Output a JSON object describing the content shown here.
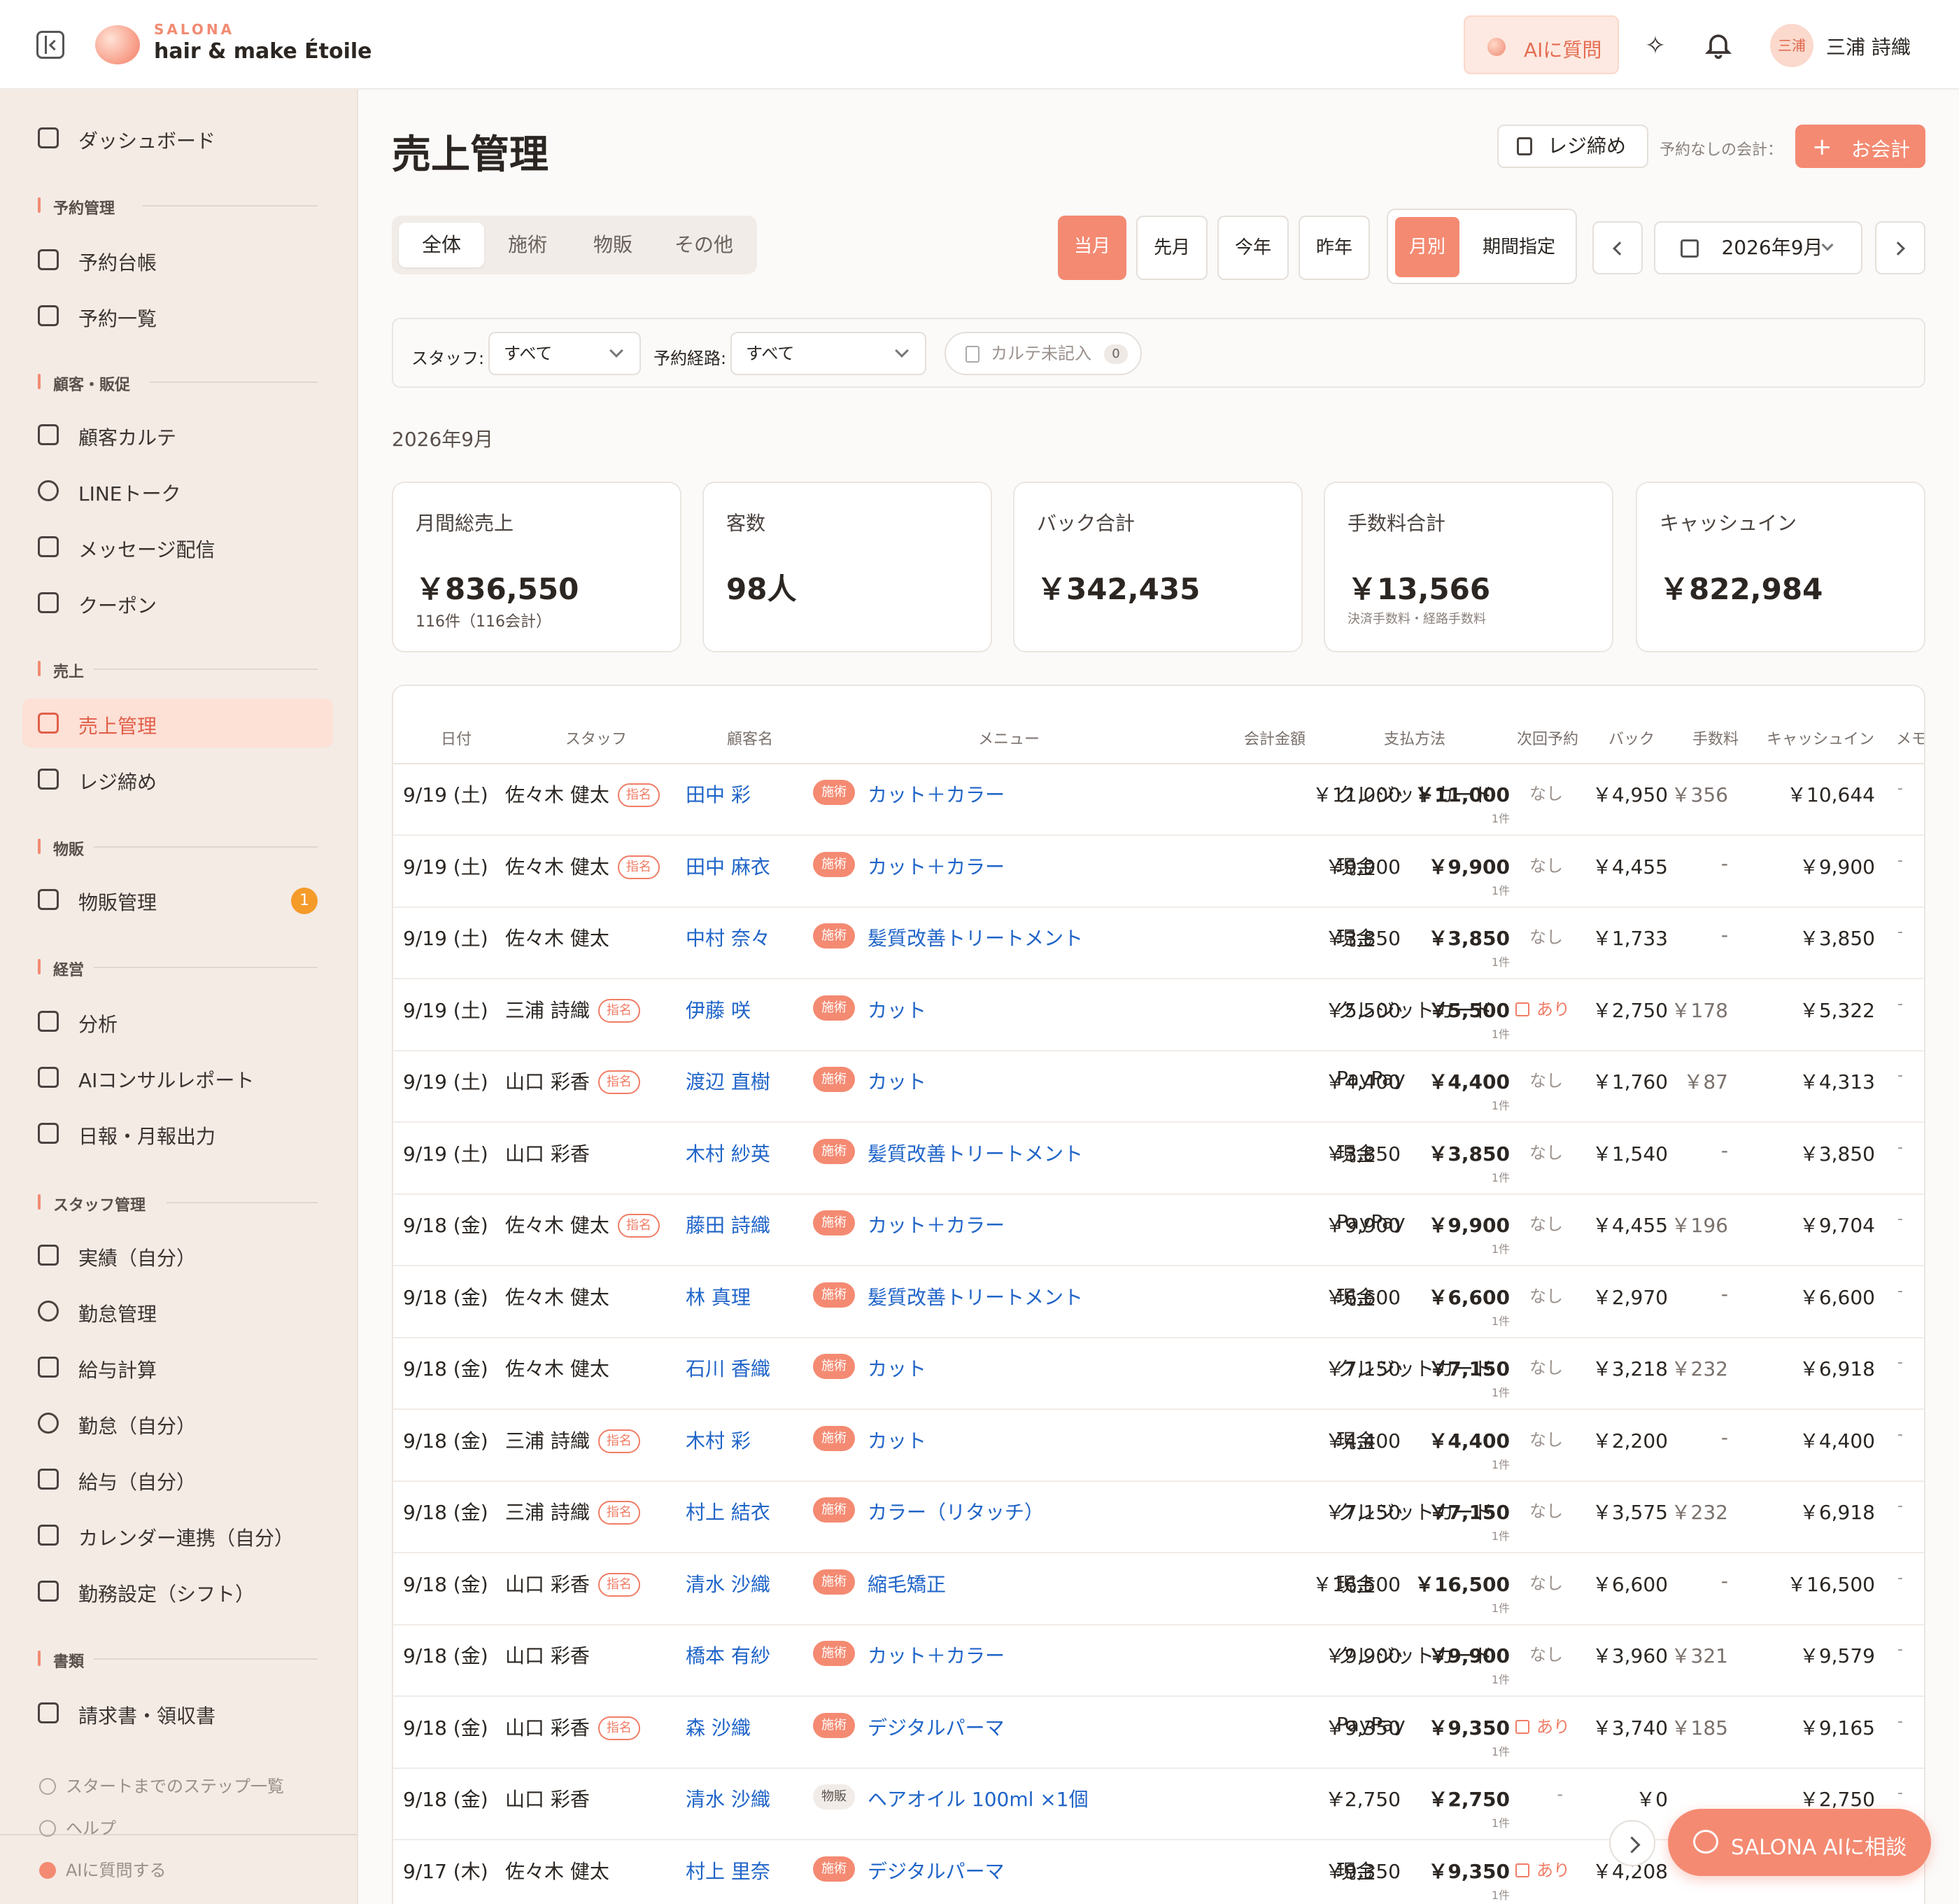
{
  "header": {
    "brand_small": "SALONA",
    "brand_name": "hair & make Étoile",
    "ai_button": "AIに質問",
    "avatar_text": "三浦",
    "user_name": "三浦 詩織"
  },
  "sidebar": {
    "dashboard": "ダッシュボード",
    "sections": {
      "reservation": "予約管理",
      "customer": "顧客・販促",
      "sales": "売上",
      "goods": "物販",
      "management": "経営",
      "staff": "スタッフ管理",
      "docs": "書類"
    },
    "items": {
      "reservation_book": "予約台帳",
      "reservation_list": "予約一覧",
      "karte": "顧客カルテ",
      "line": "LINEトーク",
      "message": "メッセージ配信",
      "coupon": "クーポン",
      "sales_mgmt": "売上管理",
      "register_close": "レジ締め",
      "goods_mgmt": "物販管理",
      "analysis": "分析",
      "ai_report": "AIコンサルレポート",
      "daily_report": "日報・月報出力",
      "performance": "実績（自分）",
      "attendance_mgmt": "勤怠管理",
      "payroll": "給与計算",
      "attendance_self": "勤怠（自分）",
      "salary_self": "給与（自分）",
      "calendar_sync": "カレンダー連携（自分）",
      "shift_setting": "勤務設定（シフト）",
      "invoice": "請求書・領収書"
    },
    "goods_badge": "1",
    "footer": {
      "steps": "スタートまでのステップ一覧",
      "help": "ヘルプ",
      "ask_ai": "AIに質問する"
    }
  },
  "main": {
    "title": "売上管理",
    "register_close_button": "レジ締め",
    "no_reservation_hint": "予約なしの会計：",
    "checkout_button": "お会計",
    "tabs": [
      "全体",
      "施術",
      "物販",
      "その他"
    ],
    "periods": [
      "当月",
      "先月",
      "今年",
      "昨年"
    ],
    "modes": [
      "月別",
      "期間指定"
    ],
    "month_select": "2026年9月",
    "filters": {
      "staff_label": "スタッフ:",
      "staff_value": "すべて",
      "route_label": "予約経路:",
      "route_value": "すべて",
      "karte_unfilled": "カルテ未記入",
      "karte_count": "0"
    },
    "period_label": "2026年9月",
    "cards": [
      {
        "title": "月間総売上",
        "value": "￥836,550",
        "sub": "116件（116会計）"
      },
      {
        "title": "客数",
        "value": "98人",
        "sub": ""
      },
      {
        "title": "バック合計",
        "value": "￥342,435",
        "sub": ""
      },
      {
        "title": "手数料合計",
        "value": "￥13,566",
        "sub": "決済手数料・経路手数料"
      },
      {
        "title": "キャッシュイン",
        "value": "￥822,984",
        "sub": ""
      }
    ],
    "table": {
      "headers": [
        "日付",
        "スタッフ",
        "顧客名",
        "メニュー",
        "会計金額",
        "支払方法",
        "次回予約",
        "バック",
        "手数料",
        "キャッシュイン",
        "メモ"
      ],
      "shimei_label": "指名",
      "count_label": "1件",
      "rows": [
        {
          "date": "9/19 (土)",
          "staff": "佐々木 健太",
          "shimei": true,
          "customer": "田中 彩",
          "tag": "施術",
          "menu": "カット＋カラー",
          "price": "￥11,000",
          "total": "￥11,000",
          "pay": "クレジットカード",
          "next": "なし",
          "back": "￥4,950",
          "fee": "￥356",
          "cashin": "￥10,644",
          "memo": "-"
        },
        {
          "date": "9/19 (土)",
          "staff": "佐々木 健太",
          "shimei": true,
          "customer": "田中 麻衣",
          "tag": "施術",
          "menu": "カット＋カラー",
          "price": "￥9,900",
          "total": "￥9,900",
          "pay": "現金",
          "next": "なし",
          "back": "￥4,455",
          "fee": "-",
          "cashin": "￥9,900",
          "memo": "-"
        },
        {
          "date": "9/19 (土)",
          "staff": "佐々木 健太",
          "shimei": false,
          "customer": "中村 奈々",
          "tag": "施術",
          "menu": "髪質改善トリートメント",
          "price": "￥3,850",
          "total": "￥3,850",
          "pay": "現金",
          "next": "なし",
          "back": "￥1,733",
          "fee": "-",
          "cashin": "￥3,850",
          "memo": "-"
        },
        {
          "date": "9/19 (土)",
          "staff": "三浦 詩織",
          "shimei": true,
          "customer": "伊藤 咲",
          "tag": "施術",
          "menu": "カット",
          "price": "￥5,500",
          "total": "￥5,500",
          "pay": "クレジットカード",
          "next": "あり",
          "back": "￥2,750",
          "fee": "￥178",
          "cashin": "￥5,322",
          "memo": "-"
        },
        {
          "date": "9/19 (土)",
          "staff": "山口 彩香",
          "shimei": true,
          "customer": "渡辺 直樹",
          "tag": "施術",
          "menu": "カット",
          "price": "￥4,400",
          "total": "￥4,400",
          "pay": "PayPay",
          "next": "なし",
          "back": "￥1,760",
          "fee": "￥87",
          "cashin": "￥4,313",
          "memo": "-"
        },
        {
          "date": "9/19 (土)",
          "staff": "山口 彩香",
          "shimei": false,
          "customer": "木村 紗英",
          "tag": "施術",
          "menu": "髪質改善トリートメント",
          "price": "￥3,850",
          "total": "￥3,850",
          "pay": "現金",
          "next": "なし",
          "back": "￥1,540",
          "fee": "-",
          "cashin": "￥3,850",
          "memo": "-"
        },
        {
          "date": "9/18 (金)",
          "staff": "佐々木 健太",
          "shimei": true,
          "customer": "藤田 詩織",
          "tag": "施術",
          "menu": "カット＋カラー",
          "price": "￥9,900",
          "total": "￥9,900",
          "pay": "PayPay",
          "next": "なし",
          "back": "￥4,455",
          "fee": "￥196",
          "cashin": "￥9,704",
          "memo": "-"
        },
        {
          "date": "9/18 (金)",
          "staff": "佐々木 健太",
          "shimei": false,
          "customer": "林 真理",
          "tag": "施術",
          "menu": "髪質改善トリートメント",
          "price": "￥6,600",
          "total": "￥6,600",
          "pay": "現金",
          "next": "なし",
          "back": "￥2,970",
          "fee": "-",
          "cashin": "￥6,600",
          "memo": "-"
        },
        {
          "date": "9/18 (金)",
          "staff": "佐々木 健太",
          "shimei": false,
          "customer": "石川 香織",
          "tag": "施術",
          "menu": "カット",
          "price": "￥7,150",
          "total": "￥7,150",
          "pay": "クレジットカード",
          "next": "なし",
          "back": "￥3,218",
          "fee": "￥232",
          "cashin": "￥6,918",
          "memo": "-"
        },
        {
          "date": "9/18 (金)",
          "staff": "三浦 詩織",
          "shimei": true,
          "customer": "木村 彩",
          "tag": "施術",
          "menu": "カット",
          "price": "￥4,400",
          "total": "￥4,400",
          "pay": "現金",
          "next": "なし",
          "back": "￥2,200",
          "fee": "-",
          "cashin": "￥4,400",
          "memo": "-"
        },
        {
          "date": "9/18 (金)",
          "staff": "三浦 詩織",
          "shimei": true,
          "customer": "村上 結衣",
          "tag": "施術",
          "menu": "カラー（リタッチ）",
          "price": "￥7,150",
          "total": "￥7,150",
          "pay": "クレジットカード",
          "next": "なし",
          "back": "￥3,575",
          "fee": "￥232",
          "cashin": "￥6,918",
          "memo": "-"
        },
        {
          "date": "9/18 (金)",
          "staff": "山口 彩香",
          "shimei": true,
          "customer": "清水 沙織",
          "tag": "施術",
          "menu": "縮毛矯正",
          "price": "￥16,500",
          "total": "￥16,500",
          "pay": "現金",
          "next": "なし",
          "back": "￥6,600",
          "fee": "-",
          "cashin": "￥16,500",
          "memo": "-"
        },
        {
          "date": "9/18 (金)",
          "staff": "山口 彩香",
          "shimei": false,
          "customer": "橋本 有紗",
          "tag": "施術",
          "menu": "カット＋カラー",
          "price": "￥9,900",
          "total": "￥9,900",
          "pay": "クレジットカード",
          "next": "なし",
          "back": "￥3,960",
          "fee": "￥321",
          "cashin": "￥9,579",
          "memo": "-"
        },
        {
          "date": "9/18 (金)",
          "staff": "山口 彩香",
          "shimei": true,
          "customer": "森 沙織",
          "tag": "施術",
          "menu": "デジタルパーマ",
          "price": "￥9,350",
          "total": "￥9,350",
          "pay": "PayPay",
          "next": "あり",
          "back": "￥3,740",
          "fee": "￥185",
          "cashin": "￥9,165",
          "memo": "-"
        },
        {
          "date": "9/18 (金)",
          "staff": "山口 彩香",
          "shimei": false,
          "customer": "清水 沙織",
          "tag": "物販",
          "menu": "ヘアオイル 100ml ×1個",
          "price": "￥2,750",
          "total": "￥2,750",
          "pay": "-",
          "next": "-",
          "back": "￥0",
          "fee": "",
          "cashin": "￥2,750",
          "memo": "-"
        },
        {
          "date": "9/17 (木)",
          "staff": "佐々木 健太",
          "shimei": false,
          "customer": "村上 里奈",
          "tag": "施術",
          "menu": "デジタルパーマ",
          "price": "￥9,350",
          "total": "￥9,350",
          "pay": "現金",
          "next": "あり",
          "back": "￥4,208",
          "fee": "",
          "cashin": "",
          "memo": ""
        }
      ]
    }
  },
  "fab": {
    "chat": "SALONA AIに相談"
  },
  "colors": {
    "accent": "#f48a72",
    "link": "#1f64c8",
    "sidebar_bg": "#f4ebe5"
  }
}
